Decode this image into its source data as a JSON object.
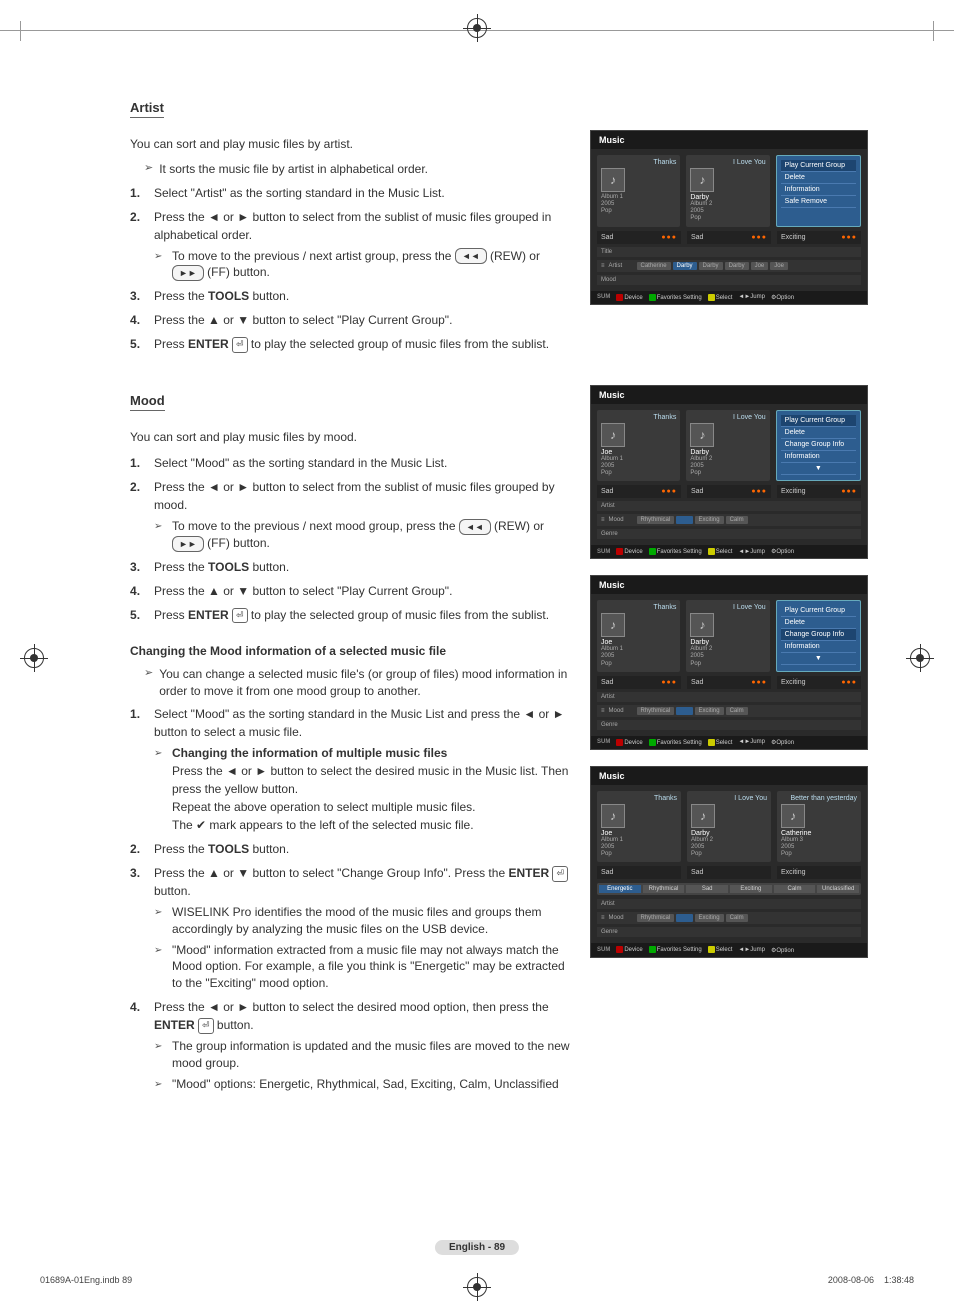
{
  "sections": {
    "artist": {
      "title": "Artist",
      "intro": "You can sort and play music files by artist.",
      "note": "It sorts the music file by artist in alphabetical order.",
      "steps": {
        "s1": "Select \"Artist\" as the sorting standard in the Music List.",
        "s2a": "Press the ◄ or ► button to select from the sublist of music files grouped in alphabetical order.",
        "s2_note_a": "To move to the previous / next artist group, press the ",
        "s2_note_b": " (REW) or ",
        "s2_note_c": " (FF) button.",
        "s3_a": "Press the ",
        "s3_b": " button.",
        "s4": "Press the ▲ or ▼ button to select \"Play Current Group\".",
        "s5_a": "Press ",
        "s5_b": " to play the selected group of music files from the sublist."
      }
    },
    "mood": {
      "title": "Mood",
      "intro": "You can sort and play music files by mood.",
      "steps": {
        "s1": "Select \"Mood\" as the sorting standard in the Music List.",
        "s2a": "Press the ◄ or ► button to select from the sublist of music files grouped by mood.",
        "s2_note_a": "To move to the previous / next mood group, press the ",
        "s2_note_b": " (REW) or ",
        "s2_note_c": " (FF) button.",
        "s3_a": "Press the ",
        "s3_b": " button.",
        "s4": "Press the ▲ or ▼ button to select \"Play Current Group\".",
        "s5_a": "Press ",
        "s5_b": " to play the selected group of music files from the sublist."
      },
      "change_title": "Changing the Mood information of a selected music file",
      "change_note": "You can change a selected music file's (or group of files) mood information in order to move it from one mood group to another.",
      "c_steps": {
        "s1": "Select \"Mood\" as the sorting standard in the Music List and press the ◄ or ► button to select a music file.",
        "s1_sub_title": "Changing the information of multiple music files",
        "s1_sub_l1": "Press the ◄ or ► button to select the desired music in the Music list. Then press the yellow button.",
        "s1_sub_l2": "Repeat the above operation to select multiple music files.",
        "s1_sub_l3": "The ✔ mark appears to the left of the selected music file.",
        "s2_a": "Press the ",
        "s2_b": " button.",
        "s3_a": "Press the ▲ or ▼ button to select \"Change Group Info\". Press the ",
        "s3_b": " button.",
        "s3_note1": "WISELINK Pro identifies the mood of the music files and groups them accordingly by analyzing the music files on the USB device.",
        "s3_note2": "\"Mood\" information extracted from a music file may not always match the Mood option. For example, a file you think is \"Energetic\" may be extracted to the \"Exciting\" mood option.",
        "s4_a": "Press the ◄ or ► button to select the desired mood option, then press the ",
        "s4_b": " button.",
        "s4_note1": "The group information is updated and the music files are moved to the new mood group.",
        "s4_note2": "\"Mood\" options: Energetic, Rhythmical, Sad, Exciting, Calm, Unclassified"
      }
    }
  },
  "labels": {
    "tools": "TOOLS",
    "enter": "ENTER",
    "enter_icon": "⏎",
    "rew": "◄◄",
    "ff": "►►"
  },
  "panels": {
    "common": {
      "title": "Music",
      "card1_top": "Thanks",
      "card1_artist": "Joe",
      "card1_album": "Album 1",
      "card1_year": "2005",
      "card1_genre": "Pop",
      "card2_top": "I Love You",
      "card2_artist": "Darby",
      "card2_album": "Album 2",
      "card2_year": "2005",
      "card2_genre": "Pop",
      "card3_top": "Better than yesterday",
      "card3_artist": "Catherine",
      "card3_album": "Album 3",
      "card3_year": "2005",
      "card3_genre": "Pop",
      "mood_sad": "Sad",
      "mood_exciting": "Exciting",
      "sum": "SUM",
      "sb_device": "Device",
      "sb_fav": "Favorites Setting",
      "sb_select": "Select",
      "sb_jump": "Jump",
      "sb_option": "Option",
      "sort_title": "Title",
      "sort_artist": "Artist",
      "sort_mood": "Mood",
      "sort_genre": "Genre"
    },
    "p1": {
      "menu": [
        "Play Current Group",
        "Delete",
        "Information",
        "Safe Remove"
      ],
      "artists": [
        "Catherine",
        "",
        "Darby",
        "Darby",
        "Darby",
        "Joe",
        "Joe"
      ]
    },
    "p2": {
      "menu": [
        "Play Current Group",
        "Delete",
        "Change Group Info",
        "Information",
        "▼"
      ],
      "moods": [
        "Rhythmical",
        "",
        "",
        "Exciting",
        "",
        "Calm",
        ""
      ]
    },
    "p3": {
      "menu": [
        "Play Current Group",
        "Delete",
        "Change Group Info",
        "Information",
        "▼"
      ],
      "moods": [
        "Rhythmical",
        "",
        "",
        "Exciting",
        "",
        "Calm",
        ""
      ]
    },
    "p4": {
      "selector": [
        "Energetic",
        "Rhythmical",
        "Sad",
        "Exciting",
        "Calm",
        "Unclassified"
      ],
      "moods": [
        "Rhythmical",
        "",
        "",
        "Exciting",
        "",
        "Calm",
        ""
      ]
    }
  },
  "page_num": "English - 89",
  "footer_left": "01689A-01Eng.indb   89",
  "footer_right": "2008-08-06      1:38:48"
}
